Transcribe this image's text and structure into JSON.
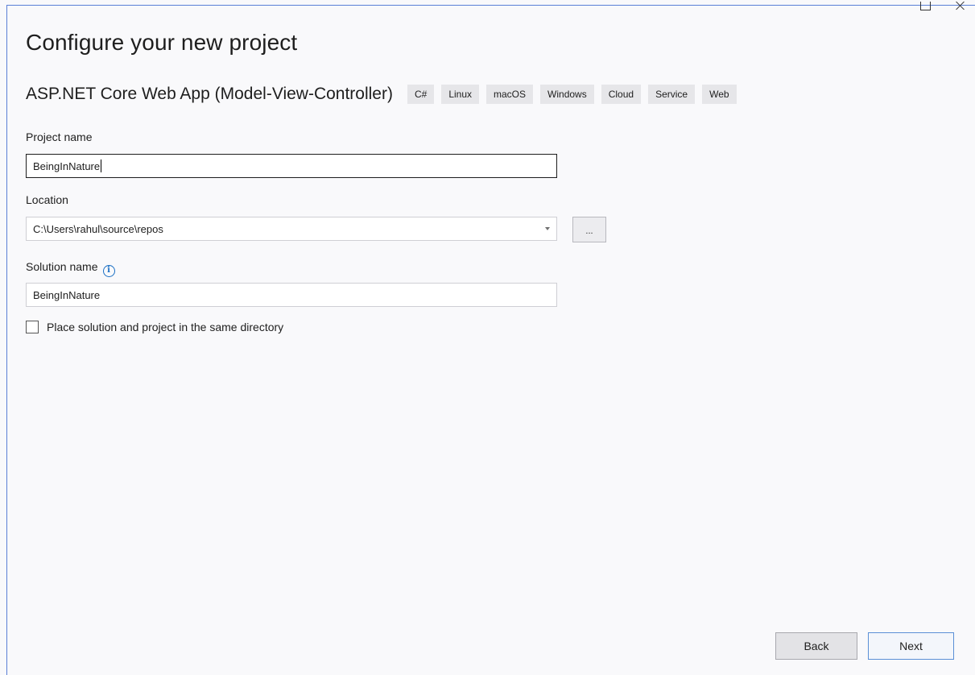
{
  "window": {
    "controls": [
      "maximize",
      "close"
    ]
  },
  "page": {
    "title": "Configure your new project"
  },
  "template": {
    "name": "ASP.NET Core Web App (Model-View-Controller)",
    "tags": [
      "C#",
      "Linux",
      "macOS",
      "Windows",
      "Cloud",
      "Service",
      "Web"
    ]
  },
  "form": {
    "project_name_label": "Project name",
    "project_name_value": "BeingInNature",
    "location_label": "Location",
    "location_value": "C:\\Users\\rahul\\source\\repos",
    "browse_label": "...",
    "solution_name_label": "Solution name",
    "solution_name_value": "BeingInNature",
    "same_directory_label": "Place solution and project in the same directory",
    "same_directory_checked": false
  },
  "footer": {
    "back_label": "Back",
    "next_label": "Next"
  },
  "icons": {
    "info": "info-icon",
    "dropdown": "chevron-down-icon",
    "maximize": "maximize-icon",
    "close": "close-icon"
  },
  "colors": {
    "accent": "#1a6fc4",
    "window_border": "#5a7fd6",
    "background": "#f9f9fb"
  }
}
